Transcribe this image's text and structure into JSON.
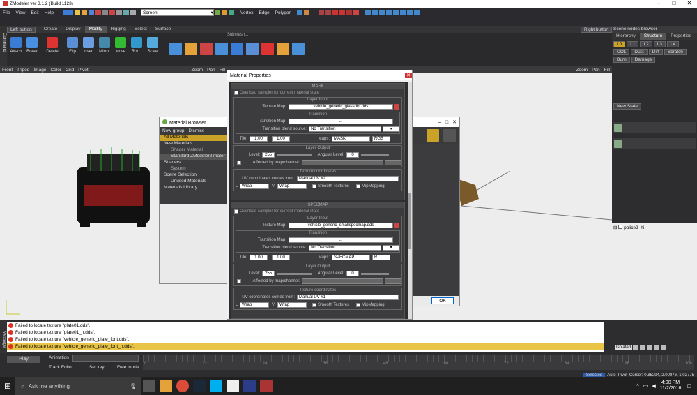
{
  "window": {
    "title": "ZModeler ver 3.1.2 (Build 1123)",
    "min": "–",
    "max": "□",
    "close": "✕"
  },
  "menu": [
    "File",
    "View",
    "Edit",
    "Help"
  ],
  "toolbar": {
    "mode_combo": "Screen",
    "vertex": "Vertex",
    "edge": "Edge",
    "polygon": "Polygon"
  },
  "left_button": "Left button",
  "right_button": "Right button",
  "command_sidebar": "Command",
  "tabs": [
    "Create",
    "Display",
    "Modify",
    "Rigging",
    "Select",
    "Surface"
  ],
  "active_tab": "Modify",
  "ribbon": {
    "buttons": [
      "Attach",
      "Break",
      "Delete",
      "Flip",
      "Insert",
      "Mirror",
      "Move",
      "Rot...",
      "Scale"
    ],
    "submesh_label": "Submesh..."
  },
  "viewport": {
    "menu": [
      "Front",
      "Tripod",
      "Image",
      "Color",
      "Grid",
      "Pivot"
    ],
    "tools": [
      "Zoom",
      "Pan",
      "Fill"
    ]
  },
  "material_browser": {
    "title": "Material Browser",
    "new_group": "New group",
    "dismiss": "Dismiss",
    "tree": [
      "All Materials",
      "New Materials",
      "Shader Material",
      "Standard ZModeler2 mater",
      "Shaders",
      "System",
      "Scene Selection",
      "Unused Materials",
      "Materials Library"
    ]
  },
  "material_properties": {
    "title": "Material Properties",
    "sections": [
      {
        "header": "MASK",
        "override": "Overload sampler for current material state",
        "layer_input": "Layer Input",
        "texture_map_label": "Texture Map:",
        "texture_map": "vehicle_generic_glassdirt.dds",
        "transition": "Transition",
        "transition_map_label": "Transition Map:",
        "transition_map": "...",
        "transition_blend_label": "Transition blend source:",
        "transition_blend": "No Transition",
        "tile_label": "Tile:",
        "tile_u": "1.00",
        "tile_v": "1.00",
        "maps_label": "Maps:",
        "maps": "MASK",
        "channel": "RGB",
        "layer_output": "Layer Output",
        "level_label": "Level:",
        "level": "255",
        "angular_label": "Angular Level:",
        "angular": "0",
        "affected_label": "Affected by map/channel:",
        "tex_coords": "Texture coordinates",
        "uv_label": "UV coordinates comes from:",
        "uv": "Manual UV #2",
        "u_wrap": "Wrap",
        "v_wrap": "Wrap",
        "smooth": "Smooth Textures",
        "mip": "MipMapping"
      },
      {
        "header": "SPECMAP",
        "override": "Overload sampler for current material state",
        "layer_input": "Layer Input",
        "texture_map_label": "Texture Map:",
        "texture_map": "vehicle_generic_smallspecmap.dds",
        "transition": "Transition",
        "transition_map_label": "Transition Map:",
        "transition_map": "...",
        "transition_blend_label": "Transition blend source:",
        "transition_blend": "No Transition",
        "tile_label": "Tile:",
        "tile_u": "1.00",
        "tile_v": "1.00",
        "maps_label": "Maps:",
        "maps": "SPECMAP",
        "channel": "R",
        "layer_output": "Layer Output",
        "level_label": "Level:",
        "level": "255",
        "angular_label": "Angular Level:",
        "angular": "0",
        "affected_label": "Affected by map/channel:",
        "tex_coords": "Texture coordinates",
        "uv_label": "UV coordinates comes from:",
        "uv": "Manual UV #1",
        "u_wrap": "Wrap",
        "v_wrap": "Wrap",
        "smooth": "Smooth Textures",
        "mip": "MipMapping"
      }
    ]
  },
  "ok_button": "OK",
  "scene_browser": {
    "title": "Scene nodes browser",
    "tabs": [
      "Hierarchy",
      "Structure",
      "Properties"
    ],
    "lods": [
      "L0",
      "L1",
      "L2",
      "L3",
      "L4",
      "COL",
      "Dust"
    ],
    "states": [
      "Dirt",
      "Scratch",
      "Burn",
      "Damage"
    ],
    "new_state": "New State",
    "node": "police2_hi",
    "isolated": "Isolated"
  },
  "log": {
    "title": "Message",
    "lines": [
      "Failed to locate texture \"plate01.dds\".",
      "Failed to locate texture \"plate01_n.dds\".",
      "Failed to locate texture \"vehicle_generic_plate_font.dds\".",
      "Failed to locate texture \"vehicle_generic_plate_font_n.dds\"."
    ]
  },
  "anim": {
    "play": "Play",
    "animation": "Animation",
    "track_editor": "Track Editor",
    "set_key": "Set key",
    "free_mode": "Free mode",
    "ticks": [
      "0",
      "12",
      "24",
      "36",
      "48",
      "60",
      "72",
      "84",
      "96",
      "108"
    ]
  },
  "status": {
    "selected": "Selected",
    "auto": "Auto",
    "pivot": "Pivot",
    "cursor": "Cursor: 0.85294, 2.00876, 1.02775"
  },
  "taskbar": {
    "search": "Ask me anything",
    "time": "4:00 PM",
    "date": "11/2/2016"
  }
}
